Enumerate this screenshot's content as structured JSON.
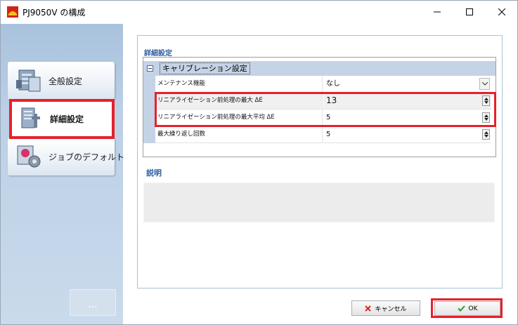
{
  "window": {
    "title": "PJ9050V の構成",
    "icons": {
      "app": "app-logo-icon",
      "minimize": "minimize-icon",
      "maximize": "maximize-icon",
      "close": "close-icon"
    }
  },
  "sidebar": {
    "items": [
      {
        "label": "全般設定",
        "icon": "general-settings-icon",
        "selected": false
      },
      {
        "label": "詳細設定",
        "icon": "advanced-settings-icon",
        "selected": true
      },
      {
        "label": "ジョブのデフォルト",
        "icon": "job-defaults-icon",
        "selected": false
      }
    ],
    "more_label": "..."
  },
  "main": {
    "section_title": "詳細設定",
    "category": {
      "label": "キャリブレーション設定",
      "expanded": true
    },
    "properties": [
      {
        "name": "メンテナンス機能",
        "value": "なし",
        "control": "dropdown"
      },
      {
        "name": "リニアライゼーション前処理の最大 ΔE",
        "value": "13",
        "control": "spinner"
      },
      {
        "name": "リニアライゼーション前処理の最大平均 ΔE",
        "value": "5",
        "control": "spinner"
      },
      {
        "name": "最大繰り返し回数",
        "value": "5",
        "control": "spinner"
      }
    ],
    "description_title": "説明",
    "description_text": ""
  },
  "buttons": {
    "cancel_label": "キャンセル",
    "ok_label": "OK"
  },
  "colors": {
    "highlight": "#e8202a",
    "section_title": "#2c5fa0",
    "sidebar": "#bcd0e6",
    "category_header": "#c5d3e6"
  }
}
